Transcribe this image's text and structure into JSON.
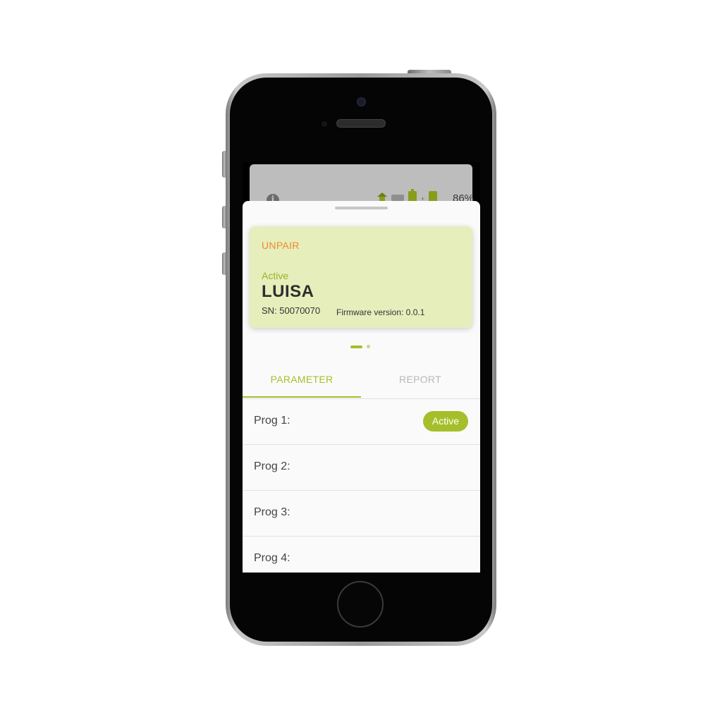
{
  "status_bar": {
    "battery_percent": "86%",
    "icons": [
      "info-icon",
      "home-icon",
      "plug-icon",
      "battery-icon",
      "battery-charging-icon"
    ]
  },
  "device_card": {
    "unpair_label": "UNPAIR",
    "status": "Active",
    "name": "LUISA",
    "serial": "SN: 50070070",
    "firmware": "Firmware version: 0.0.1"
  },
  "pager": {
    "pages": 2,
    "current": 1
  },
  "tabs": [
    {
      "label": "PARAMETER",
      "active": true
    },
    {
      "label": "REPORT",
      "active": false
    }
  ],
  "programs": [
    {
      "label": "Prog 1:",
      "badge": "Active"
    },
    {
      "label": "Prog 2:",
      "badge": ""
    },
    {
      "label": "Prog 3:",
      "badge": ""
    },
    {
      "label": "Prog 4:",
      "badge": ""
    }
  ],
  "colors": {
    "accent": "#a5bf2a",
    "unpair": "#f0892a",
    "card_background": "#e6eebc"
  }
}
